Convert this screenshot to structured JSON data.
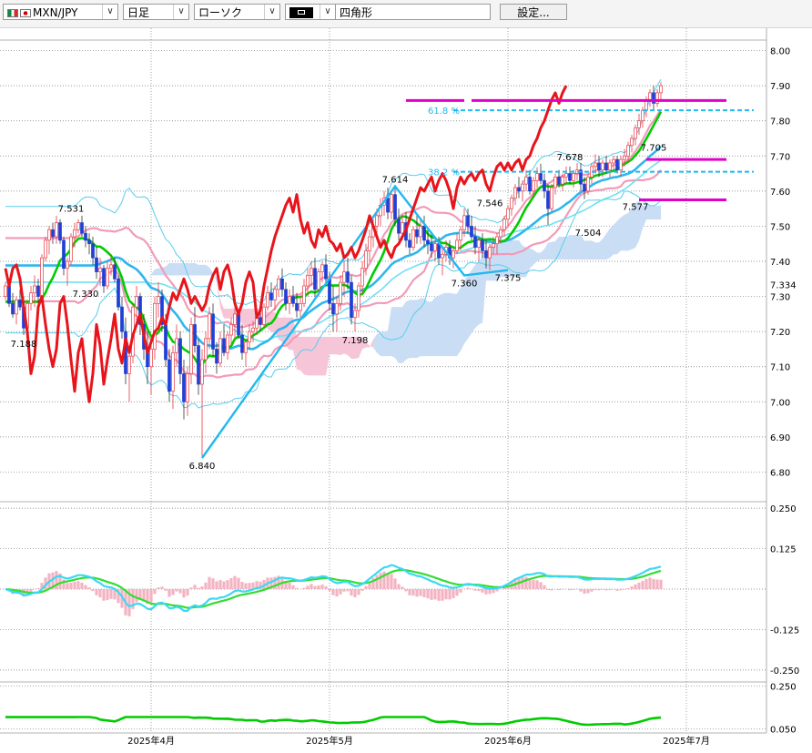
{
  "toolbar": {
    "symbol": "MXN/JPY",
    "timeframe": "日足",
    "chart_style": "ローソク",
    "drawing_tool": "四角形",
    "settings_label": "設定..."
  },
  "colors": {
    "candle_up": "#e63946",
    "candle_down": "#1f3fd6",
    "fibo": "#22b8f0",
    "price_line": "#e8141b",
    "bollinger_outer": "#58cdf0",
    "bollinger_mid": "#f39ab8",
    "ma_short": "#00cc00",
    "ma_mid": "#2fb6ee",
    "ma_long": "#6fe0f2",
    "cloud_up": "#c9def5",
    "cloud_down": "#f6c6d8",
    "resistance": "#e000c8",
    "macd_hist": "#f4b3c2",
    "macd_line": "#3bd8f5",
    "signal_line": "#33dd33"
  },
  "chart_data": [
    {
      "type": "candlestick",
      "y_ticks": [
        "8.00",
        "7.90",
        "7.80",
        "7.70",
        "7.60",
        "7.50",
        "7.40",
        "7.30",
        "7.20",
        "7.10",
        "7.00",
        "6.90",
        "6.80"
      ],
      "extra_y_labels": [
        "7.334"
      ],
      "ylim": [
        6.77,
        8.03
      ],
      "x_tick_labels": [
        {
          "label": "2025年4月",
          "index": 40
        },
        {
          "label": "2025年5月",
          "index": 89
        },
        {
          "label": "2025年6月",
          "index": 138
        },
        {
          "label": "2025年7月",
          "index": 187
        }
      ],
      "n_points": 206,
      "annotations": [
        {
          "text": "7.531",
          "i": 18,
          "y": 7.531,
          "pos": "above"
        },
        {
          "text": "7.330",
          "i": 22,
          "y": 7.33,
          "pos": "below"
        },
        {
          "text": "7.188",
          "i": 5,
          "y": 7.188,
          "pos": "below"
        },
        {
          "text": "6.840",
          "i": 54,
          "y": 6.84,
          "pos": "below"
        },
        {
          "text": "7.198",
          "i": 96,
          "y": 7.198,
          "pos": "below"
        },
        {
          "text": "7.614",
          "i": 107,
          "y": 7.614,
          "pos": "above"
        },
        {
          "text": "7.360",
          "i": 126,
          "y": 7.36,
          "pos": "below"
        },
        {
          "text": "7.546",
          "i": 133,
          "y": 7.546,
          "pos": "above"
        },
        {
          "text": "7.375",
          "i": 138,
          "y": 7.375,
          "pos": "below"
        },
        {
          "text": "7.678",
          "i": 155,
          "y": 7.678,
          "pos": "above"
        },
        {
          "text": "7.504",
          "i": 160,
          "y": 7.504,
          "pos": "below"
        },
        {
          "text": "7.705",
          "i": 178,
          "y": 7.705,
          "pos": "above"
        },
        {
          "text": "7.577",
          "i": 173,
          "y": 7.577,
          "pos": "below"
        },
        {
          "text": "61.8 %",
          "i": 116,
          "y": 7.83,
          "pos": "left"
        },
        {
          "text": "38.2 %",
          "i": 116,
          "y": 7.655,
          "pos": "left"
        }
      ],
      "candles": [
        [
          7.3,
          7.34,
          7.29,
          7.33
        ],
        [
          7.33,
          7.35,
          7.27,
          7.28
        ],
        [
          7.28,
          7.31,
          7.24,
          7.25
        ],
        [
          7.25,
          7.3,
          7.22,
          7.29
        ],
        [
          7.29,
          7.32,
          7.26,
          7.27
        ],
        [
          7.27,
          7.3,
          7.19,
          7.21
        ],
        [
          7.21,
          7.29,
          7.2,
          7.28
        ],
        [
          7.28,
          7.33,
          7.26,
          7.31
        ],
        [
          7.31,
          7.36,
          7.27,
          7.33
        ],
        [
          7.33,
          7.35,
          7.28,
          7.3
        ],
        [
          7.3,
          7.42,
          7.29,
          7.41
        ],
        [
          7.41,
          7.47,
          7.4,
          7.46
        ],
        [
          7.46,
          7.5,
          7.42,
          7.49
        ],
        [
          7.49,
          7.51,
          7.45,
          7.47
        ],
        [
          7.47,
          7.53,
          7.45,
          7.51
        ],
        [
          7.51,
          7.52,
          7.45,
          7.46
        ],
        [
          7.46,
          7.47,
          7.36,
          7.38
        ],
        [
          7.38,
          7.41,
          7.33,
          7.4
        ],
        [
          7.4,
          7.48,
          7.39,
          7.47
        ],
        [
          7.47,
          7.51,
          7.44,
          7.49
        ],
        [
          7.49,
          7.52,
          7.48,
          7.51
        ],
        [
          7.51,
          7.53,
          7.47,
          7.48
        ],
        [
          7.48,
          7.5,
          7.44,
          7.46
        ],
        [
          7.46,
          7.48,
          7.42,
          7.45
        ],
        [
          7.45,
          7.47,
          7.39,
          7.41
        ],
        [
          7.41,
          7.44,
          7.35,
          7.37
        ],
        [
          7.37,
          7.41,
          7.33,
          7.38
        ],
        [
          7.38,
          7.39,
          7.31,
          7.33
        ],
        [
          7.33,
          7.4,
          7.32,
          7.38
        ],
        [
          7.38,
          7.42,
          7.36,
          7.39
        ],
        [
          7.39,
          7.41,
          7.34,
          7.35
        ],
        [
          7.35,
          7.36,
          7.26,
          7.27
        ],
        [
          7.27,
          7.3,
          7.18,
          7.2
        ],
        [
          7.2,
          7.24,
          7.05,
          7.08
        ],
        [
          7.08,
          7.15,
          7.0,
          7.13
        ],
        [
          7.13,
          7.28,
          7.11,
          7.27
        ],
        [
          7.27,
          7.33,
          7.22,
          7.3
        ],
        [
          7.3,
          7.31,
          7.19,
          7.22
        ],
        [
          7.22,
          7.25,
          7.12,
          7.15
        ],
        [
          7.15,
          7.2,
          7.05,
          7.1
        ],
        [
          7.1,
          7.18,
          7.02,
          7.15
        ],
        [
          7.15,
          7.3,
          7.12,
          7.28
        ],
        [
          7.28,
          7.34,
          7.24,
          7.3
        ],
        [
          7.3,
          7.32,
          7.2,
          7.22
        ],
        [
          7.22,
          7.25,
          7.1,
          7.12
        ],
        [
          7.12,
          7.15,
          7.0,
          7.03
        ],
        [
          7.03,
          7.16,
          6.98,
          7.14
        ],
        [
          7.14,
          7.22,
          7.1,
          7.18
        ],
        [
          7.18,
          7.2,
          7.05,
          7.08
        ],
        [
          7.08,
          7.12,
          6.95,
          7.0
        ],
        [
          7.0,
          7.1,
          6.96,
          7.08
        ],
        [
          7.08,
          7.24,
          7.05,
          7.22
        ],
        [
          7.22,
          7.27,
          7.14,
          7.16
        ],
        [
          7.16,
          7.18,
          7.02,
          7.05
        ],
        [
          7.05,
          7.15,
          6.84,
          7.12
        ],
        [
          7.12,
          7.2,
          7.08,
          7.18
        ],
        [
          7.18,
          7.27,
          7.15,
          7.25
        ],
        [
          7.25,
          7.28,
          7.13,
          7.15
        ],
        [
          7.15,
          7.17,
          7.08,
          7.11
        ],
        [
          7.11,
          7.2,
          7.1,
          7.18
        ],
        [
          7.18,
          7.22,
          7.13,
          7.14
        ],
        [
          7.14,
          7.2,
          7.12,
          7.19
        ],
        [
          7.19,
          7.24,
          7.16,
          7.22
        ],
        [
          7.22,
          7.27,
          7.18,
          7.25
        ],
        [
          7.25,
          7.26,
          7.18,
          7.19
        ],
        [
          7.19,
          7.22,
          7.12,
          7.14
        ],
        [
          7.14,
          7.18,
          7.1,
          7.17
        ],
        [
          7.17,
          7.22,
          7.15,
          7.2
        ],
        [
          7.2,
          7.23,
          7.17,
          7.21
        ],
        [
          7.21,
          7.25,
          7.19,
          7.24
        ],
        [
          7.24,
          7.26,
          7.2,
          7.22
        ],
        [
          7.22,
          7.28,
          7.21,
          7.27
        ],
        [
          7.27,
          7.33,
          7.26,
          7.31
        ],
        [
          7.31,
          7.34,
          7.27,
          7.29
        ],
        [
          7.29,
          7.33,
          7.26,
          7.32
        ],
        [
          7.32,
          7.36,
          7.3,
          7.35
        ],
        [
          7.35,
          7.38,
          7.3,
          7.32
        ],
        [
          7.32,
          7.34,
          7.26,
          7.28
        ],
        [
          7.28,
          7.32,
          7.25,
          7.3
        ],
        [
          7.3,
          7.33,
          7.27,
          7.28
        ],
        [
          7.28,
          7.31,
          7.24,
          7.26
        ],
        [
          7.26,
          7.3,
          7.24,
          7.28
        ],
        [
          7.28,
          7.35,
          7.27,
          7.33
        ],
        [
          7.33,
          7.38,
          7.3,
          7.36
        ],
        [
          7.36,
          7.4,
          7.33,
          7.38
        ],
        [
          7.38,
          7.41,
          7.3,
          7.32
        ],
        [
          7.32,
          7.38,
          7.3,
          7.37
        ],
        [
          7.37,
          7.4,
          7.34,
          7.39
        ],
        [
          7.39,
          7.42,
          7.33,
          7.35
        ],
        [
          7.35,
          7.37,
          7.26,
          7.28
        ],
        [
          7.28,
          7.33,
          7.2,
          7.25
        ],
        [
          7.25,
          7.3,
          7.2,
          7.28
        ],
        [
          7.28,
          7.36,
          7.26,
          7.34
        ],
        [
          7.34,
          7.4,
          7.3,
          7.37
        ],
        [
          7.37,
          7.41,
          7.32,
          7.34
        ],
        [
          7.34,
          7.36,
          7.22,
          7.24
        ],
        [
          7.24,
          7.28,
          7.2,
          7.26
        ],
        [
          7.26,
          7.34,
          7.24,
          7.33
        ],
        [
          7.33,
          7.4,
          7.31,
          7.38
        ],
        [
          7.38,
          7.45,
          7.36,
          7.43
        ],
        [
          7.43,
          7.49,
          7.4,
          7.47
        ],
        [
          7.47,
          7.52,
          7.44,
          7.5
        ],
        [
          7.5,
          7.55,
          7.47,
          7.53
        ],
        [
          7.53,
          7.58,
          7.5,
          7.56
        ],
        [
          7.56,
          7.6,
          7.53,
          7.58
        ],
        [
          7.58,
          7.61,
          7.52,
          7.54
        ],
        [
          7.54,
          7.6,
          7.52,
          7.59
        ],
        [
          7.59,
          7.61,
          7.5,
          7.52
        ],
        [
          7.52,
          7.55,
          7.46,
          7.48
        ],
        [
          7.48,
          7.53,
          7.46,
          7.51
        ],
        [
          7.51,
          7.54,
          7.44,
          7.46
        ],
        [
          7.46,
          7.48,
          7.42,
          7.44
        ],
        [
          7.44,
          7.5,
          7.43,
          7.49
        ],
        [
          7.49,
          7.53,
          7.45,
          7.47
        ],
        [
          7.47,
          7.52,
          7.45,
          7.5
        ],
        [
          7.5,
          7.53,
          7.44,
          7.46
        ],
        [
          7.46,
          7.49,
          7.42,
          7.45
        ],
        [
          7.45,
          7.48,
          7.41,
          7.43
        ],
        [
          7.43,
          7.46,
          7.4,
          7.45
        ],
        [
          7.45,
          7.47,
          7.39,
          7.41
        ],
        [
          7.41,
          7.44,
          7.36,
          7.42
        ],
        [
          7.42,
          7.46,
          7.4,
          7.44
        ],
        [
          7.44,
          7.46,
          7.39,
          7.41
        ],
        [
          7.41,
          7.44,
          7.38,
          7.43
        ],
        [
          7.43,
          7.48,
          7.42,
          7.46
        ],
        [
          7.46,
          7.5,
          7.43,
          7.49
        ],
        [
          7.49,
          7.55,
          7.47,
          7.53
        ],
        [
          7.53,
          7.55,
          7.48,
          7.5
        ],
        [
          7.5,
          7.53,
          7.46,
          7.47
        ],
        [
          7.47,
          7.5,
          7.42,
          7.44
        ],
        [
          7.44,
          7.47,
          7.4,
          7.46
        ],
        [
          7.46,
          7.48,
          7.41,
          7.43
        ],
        [
          7.43,
          7.46,
          7.38,
          7.41
        ],
        [
          7.41,
          7.45,
          7.375,
          7.44
        ],
        [
          7.44,
          7.47,
          7.42,
          7.45
        ],
        [
          7.45,
          7.48,
          7.42,
          7.47
        ],
        [
          7.47,
          7.5,
          7.45,
          7.49
        ],
        [
          7.49,
          7.53,
          7.47,
          7.52
        ],
        [
          7.52,
          7.56,
          7.5,
          7.55
        ],
        [
          7.55,
          7.59,
          7.53,
          7.58
        ],
        [
          7.58,
          7.62,
          7.56,
          7.61
        ],
        [
          7.61,
          7.64,
          7.58,
          7.6
        ],
        [
          7.6,
          7.63,
          7.57,
          7.62
        ],
        [
          7.62,
          7.66,
          7.6,
          7.64
        ],
        [
          7.64,
          7.66,
          7.59,
          7.6
        ],
        [
          7.6,
          7.64,
          7.58,
          7.63
        ],
        [
          7.63,
          7.668,
          7.61,
          7.65
        ],
        [
          7.65,
          7.678,
          7.62,
          7.63
        ],
        [
          7.63,
          7.65,
          7.58,
          7.6
        ],
        [
          7.6,
          7.62,
          7.504,
          7.55
        ],
        [
          7.55,
          7.62,
          7.54,
          7.61
        ],
        [
          7.61,
          7.65,
          7.59,
          7.64
        ],
        [
          7.64,
          7.66,
          7.61,
          7.62
        ],
        [
          7.62,
          7.65,
          7.6,
          7.64
        ],
        [
          7.64,
          7.67,
          7.62,
          7.65
        ],
        [
          7.65,
          7.67,
          7.62,
          7.63
        ],
        [
          7.63,
          7.66,
          7.61,
          7.65
        ],
        [
          7.65,
          7.68,
          7.63,
          7.66
        ],
        [
          7.66,
          7.68,
          7.6,
          7.62
        ],
        [
          7.62,
          7.64,
          7.577,
          7.6
        ],
        [
          7.6,
          7.65,
          7.59,
          7.64
        ],
        [
          7.64,
          7.68,
          7.62,
          7.67
        ],
        [
          7.67,
          7.705,
          7.65,
          7.68
        ],
        [
          7.68,
          7.7,
          7.64,
          7.66
        ],
        [
          7.66,
          7.69,
          7.64,
          7.68
        ],
        [
          7.68,
          7.7,
          7.65,
          7.66
        ],
        [
          7.66,
          7.69,
          7.64,
          7.68
        ],
        [
          7.68,
          7.7,
          7.66,
          7.69
        ],
        [
          7.69,
          7.7,
          7.65,
          7.66
        ],
        [
          7.66,
          7.7,
          7.64,
          7.69
        ],
        [
          7.69,
          7.72,
          7.67,
          7.7
        ],
        [
          7.7,
          7.74,
          7.68,
          7.73
        ],
        [
          7.73,
          7.76,
          7.71,
          7.75
        ],
        [
          7.75,
          7.79,
          7.73,
          7.78
        ],
        [
          7.78,
          7.82,
          7.76,
          7.8
        ],
        [
          7.8,
          7.84,
          7.78,
          7.83
        ],
        [
          7.83,
          7.87,
          7.81,
          7.86
        ],
        [
          7.86,
          7.89,
          7.84,
          7.88
        ],
        [
          7.88,
          7.9,
          7.83,
          7.85
        ],
        [
          7.85,
          7.89,
          7.84,
          7.88
        ],
        [
          7.88,
          7.91,
          7.86,
          7.9
        ]
      ]
    },
    {
      "type": "line",
      "y_ticks": [
        "0.250",
        "0.125",
        "-0.125",
        "-0.250"
      ],
      "ylim": [
        -0.27,
        0.27
      ]
    },
    {
      "type": "line",
      "y_ticks": [
        "0.250",
        "0.050"
      ],
      "ylim": [
        0.03,
        0.27
      ]
    }
  ]
}
